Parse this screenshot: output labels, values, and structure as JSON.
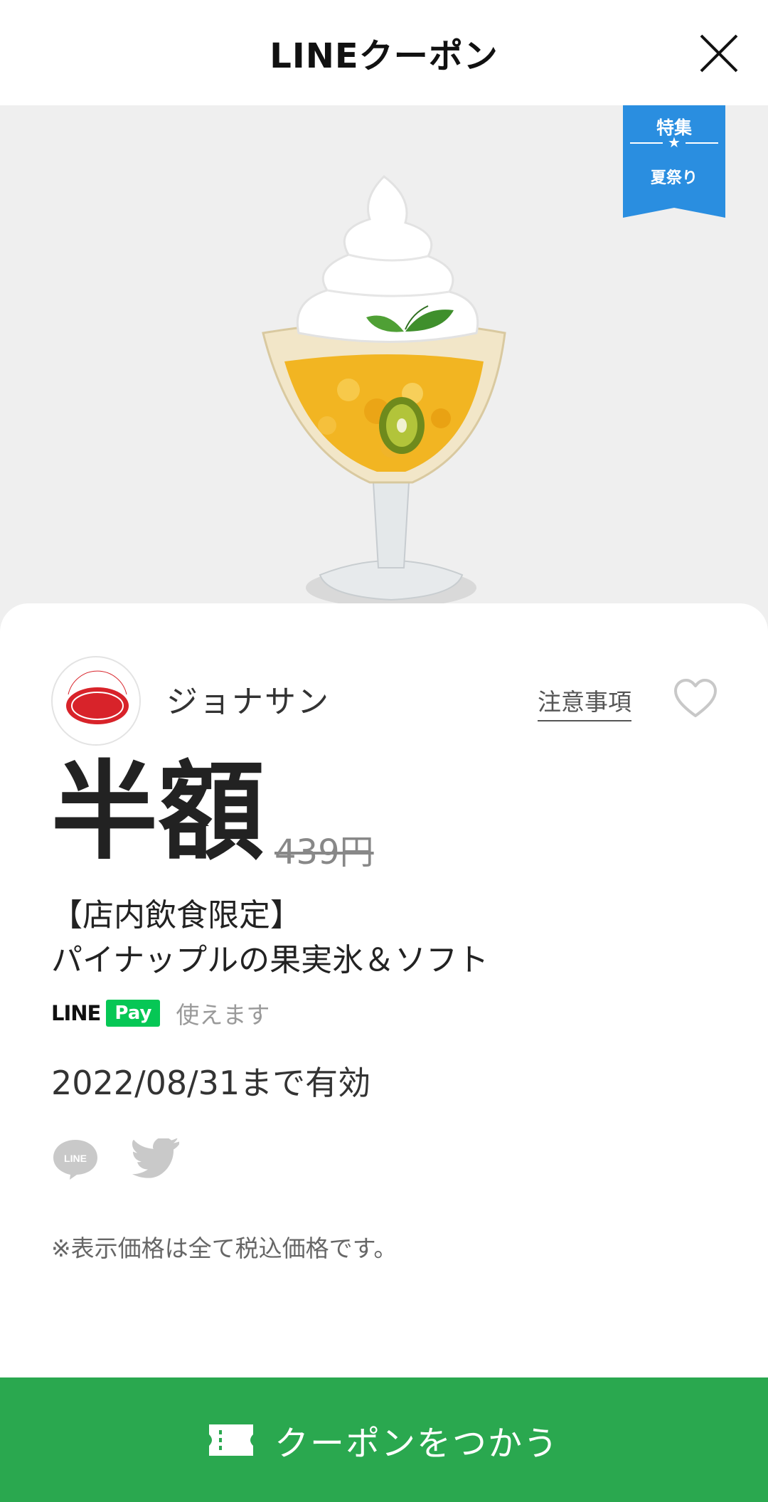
{
  "header": {
    "title": "LINEクーポン"
  },
  "ribbon": {
    "line1": "特集",
    "line2": "夏祭り"
  },
  "store": {
    "name": "ジョナサン",
    "notes_label": "注意事項"
  },
  "coupon": {
    "discount": "半額",
    "original_price": "439円",
    "title_line1": "【店内飲食限定】",
    "title_line2": "パイナップルの果実氷＆ソフト",
    "valid_until": "2022/08/31まで有効",
    "tax_note": "※表示価格は全て税込価格です。"
  },
  "linepay": {
    "line_text": "LINE",
    "pay_text": "Pay",
    "usable_text": "使えます"
  },
  "cta": {
    "label": "クーポンをつかう"
  },
  "colors": {
    "accent_green": "#2aa84f",
    "ribbon_blue": "#2a8ee0",
    "linepay_green": "#06c755"
  }
}
